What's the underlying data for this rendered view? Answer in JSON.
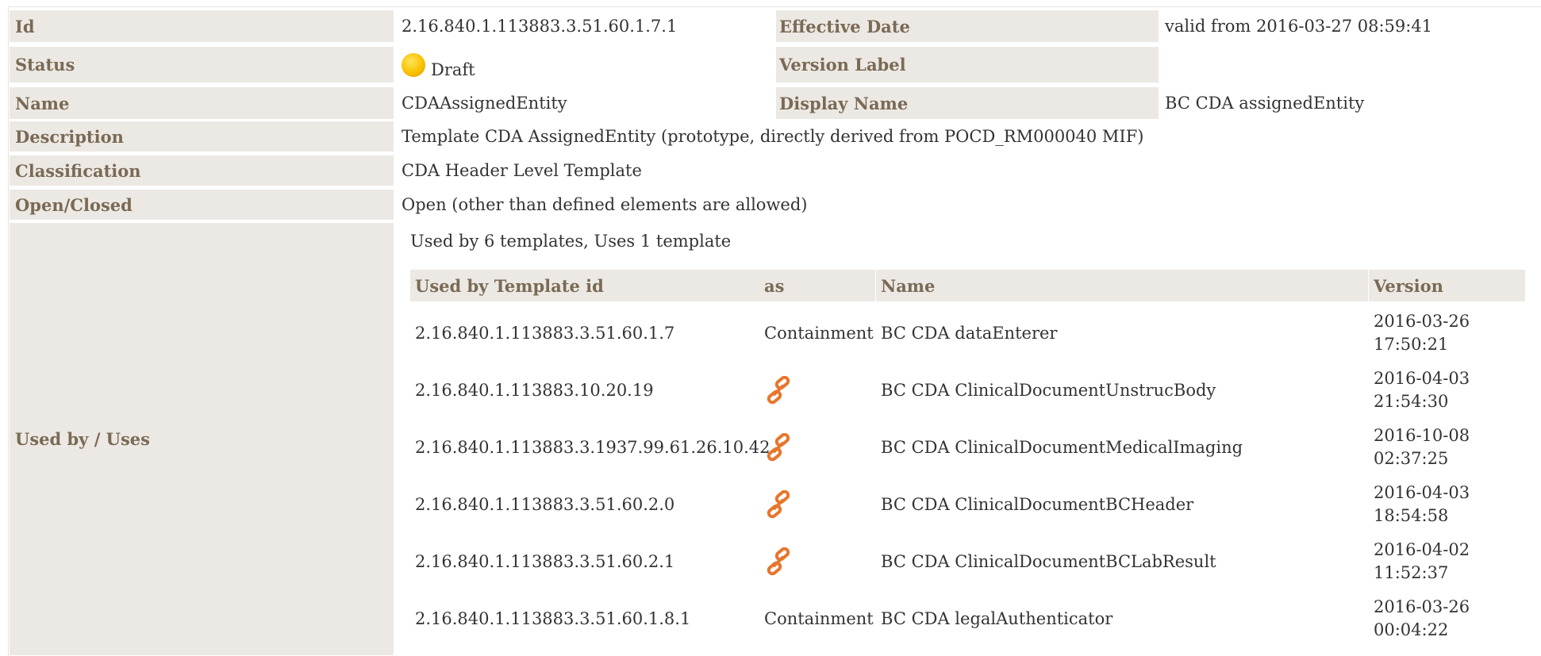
{
  "fields": {
    "id": {
      "label": "Id",
      "value": "2.16.840.1.113883.3.51.60.1.7.1"
    },
    "effective_date": {
      "label": "Effective Date",
      "value": "valid from 2016-03-27 08:59:41"
    },
    "status": {
      "label": "Status",
      "value": "Draft",
      "icon": "draft-status-dot-icon",
      "icon_color": "#f9c100"
    },
    "version_label": {
      "label": "Version Label",
      "value": ""
    },
    "name": {
      "label": "Name",
      "value": "CDAAssignedEntity"
    },
    "display_name": {
      "label": "Display Name",
      "value": "BC CDA assignedEntity"
    },
    "description": {
      "label": "Description",
      "value": "Template CDA AssignedEntity (prototype, directly derived from POCD_RM000040 MIF)"
    },
    "classification": {
      "label": "Classification",
      "value": "CDA Header Level Template"
    },
    "open_closed": {
      "label": "Open/Closed",
      "value": "Open (other than defined elements are allowed)"
    },
    "used_by": {
      "label": "Used by / Uses",
      "summary": "Used by 6 templates, Uses 1 template"
    }
  },
  "used_by_table": {
    "headers": [
      "Used by Template id",
      "as",
      "Name",
      "Version"
    ],
    "rows": [
      {
        "id": "2.16.840.1.113883.3.51.60.1.7",
        "as": "Containment",
        "name": "BC CDA dataEnterer",
        "version_date": "2016-03-26",
        "version_time": "17:50:21"
      },
      {
        "id": "2.16.840.1.113883.10.20.19",
        "as": "",
        "as_icon": "link-icon",
        "name": "BC CDA ClinicalDocumentUnstrucBody",
        "version_date": "2016-04-03",
        "version_time": "21:54:30"
      },
      {
        "id": "2.16.840.1.113883.3.1937.99.61.26.10.42",
        "as": "",
        "as_icon": "link-icon",
        "name": "BC CDA ClinicalDocumentMedicalImaging",
        "version_date": "2016-10-08",
        "version_time": "02:37:25"
      },
      {
        "id": "2.16.840.1.113883.3.51.60.2.0",
        "as": "",
        "as_icon": "link-icon",
        "name": "BC CDA ClinicalDocumentBCHeader",
        "version_date": "2016-04-03",
        "version_time": "18:54:58"
      },
      {
        "id": "2.16.840.1.113883.3.51.60.2.1",
        "as": "",
        "as_icon": "link-icon",
        "name": "BC CDA ClinicalDocumentBCLabResult",
        "version_date": "2016-04-02",
        "version_time": "11:52:37"
      },
      {
        "id": "2.16.840.1.113883.3.51.60.1.8.1",
        "as": "Containment",
        "name": "BC CDA legalAuthenticator",
        "version_date": "2016-03-26",
        "version_time": "00:04:22"
      }
    ]
  },
  "colors": {
    "label_bg": "#ece9e4",
    "label_text": "#7a6a55",
    "link_icon": "#e8762c"
  }
}
